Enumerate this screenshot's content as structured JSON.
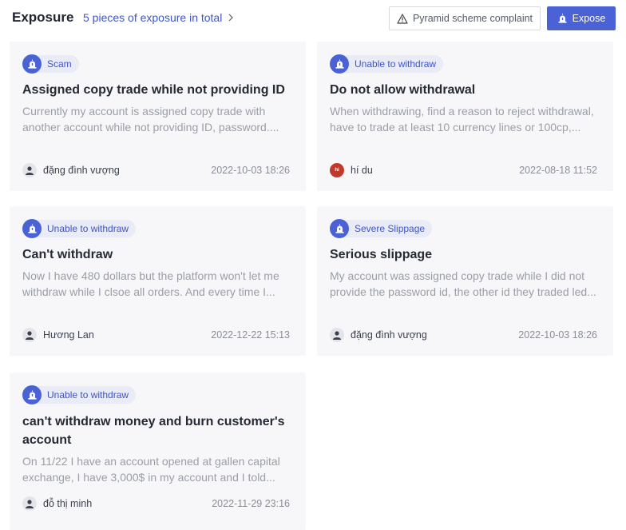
{
  "header": {
    "title": "Exposure",
    "total_text": "5 pieces of exposure in total",
    "complaint_button": "Pyramid scheme complaint",
    "expose_button": "Expose"
  },
  "colors": {
    "accent": "#4a62d6",
    "tag_bg": "#e9ebf7",
    "card_bg": "#f7f7f9"
  },
  "cards": [
    {
      "tag": "Scam",
      "title": "Assigned copy trade while not providing ID",
      "description": "Currently my account is assigned copy trade with another account while not providing ID, password....",
      "author": "đặng đình vượng",
      "avatar": "person-icon",
      "date": "2022-10-03 18:26"
    },
    {
      "tag": "Unable to withdraw",
      "title": "Do not allow withdrawal",
      "description": "When withdrawing, find a reason to reject withdrawal, have to trade at least 10 currency lines or 100cp,...",
      "author": "hí du",
      "avatar": "hi",
      "date": "2022-08-18 11:52"
    },
    {
      "tag": "Unable to withdraw",
      "title": "Can't withdraw",
      "description": "Now I have 480 dollars but the platform won't let me withdraw while I clsoe all orders. And every time I...",
      "author": "Hương Lan",
      "avatar": "person-icon",
      "date": "2022-12-22 15:13"
    },
    {
      "tag": "Severe Slippage",
      "title": "Serious slippage",
      "description": "My account was assigned copy trade while I did not provide the password id, the other id they traded led...",
      "author": "đặng đình vượng",
      "avatar": "person-icon",
      "date": "2022-10-03 18:26"
    },
    {
      "tag": "Unable to withdraw",
      "title": "can't withdraw money and burn customer's account",
      "description": "On 11/22 I have an account opened at gallen capital exchange, I have 3,000$ in my account and I told...",
      "author": "đỗ thị minh",
      "avatar": "person-icon",
      "date": "2022-11-29 23:16"
    }
  ]
}
